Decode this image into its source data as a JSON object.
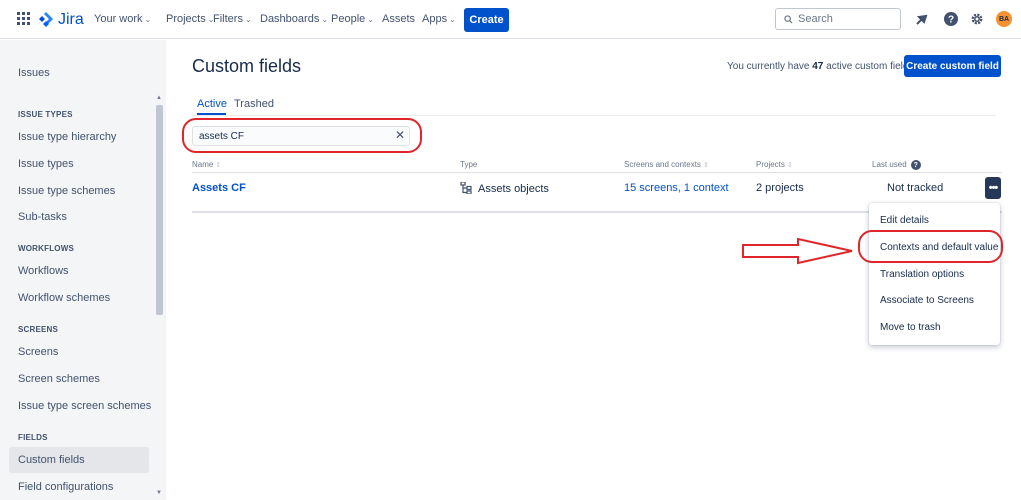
{
  "topnav": {
    "logo_text": "Jira",
    "items": [
      {
        "label": "Your work",
        "has_chevron": true
      },
      {
        "label": "Projects",
        "has_chevron": true
      },
      {
        "label": "Filters",
        "has_chevron": true
      },
      {
        "label": "Dashboards",
        "has_chevron": true
      },
      {
        "label": "People",
        "has_chevron": true
      },
      {
        "label": "Assets",
        "has_chevron": false
      },
      {
        "label": "Apps",
        "has_chevron": true
      }
    ],
    "create_label": "Create",
    "search_placeholder": "Search",
    "avatar_initials": "BA",
    "icons": [
      "app-switcher-icon",
      "notifications-icon",
      "help-icon",
      "settings-icon"
    ]
  },
  "sidebar": {
    "title": "Issues",
    "sections": [
      {
        "heading": "ISSUE TYPES",
        "items": [
          "Issue type hierarchy",
          "Issue types",
          "Issue type schemes",
          "Sub-tasks"
        ]
      },
      {
        "heading": "WORKFLOWS",
        "items": [
          "Workflows",
          "Workflow schemes"
        ]
      },
      {
        "heading": "SCREENS",
        "items": [
          "Screens",
          "Screen schemes",
          "Issue type screen schemes"
        ]
      },
      {
        "heading": "FIELDS",
        "items": [
          "Custom fields",
          "Field configurations"
        ]
      }
    ],
    "active_item": "Custom fields"
  },
  "main": {
    "title": "Custom fields",
    "active_info": {
      "prefix": "You currently have ",
      "count": "47",
      "suffix": " active custom fields"
    },
    "create_button": "Create custom field",
    "tabs": [
      {
        "label": "Active",
        "active": true
      },
      {
        "label": "Trashed",
        "active": false
      }
    ],
    "filter_value": "assets CF",
    "table": {
      "headers": [
        "Name",
        "Type",
        "Screens and contexts",
        "Projects",
        "Last used"
      ],
      "rows": [
        {
          "name": "Assets CF",
          "type": "Assets objects",
          "screens": "15 screens, 1 context",
          "projects": "2 projects",
          "last_used": "Not tracked"
        }
      ]
    },
    "more_button": "•••"
  },
  "menu": {
    "items": [
      "Edit details",
      "Contexts and default value",
      "Translation options",
      "Associate to Screens",
      "Move to trash"
    ]
  },
  "colors": {
    "accent": "#0052cc",
    "annotation": "#e0262b"
  }
}
